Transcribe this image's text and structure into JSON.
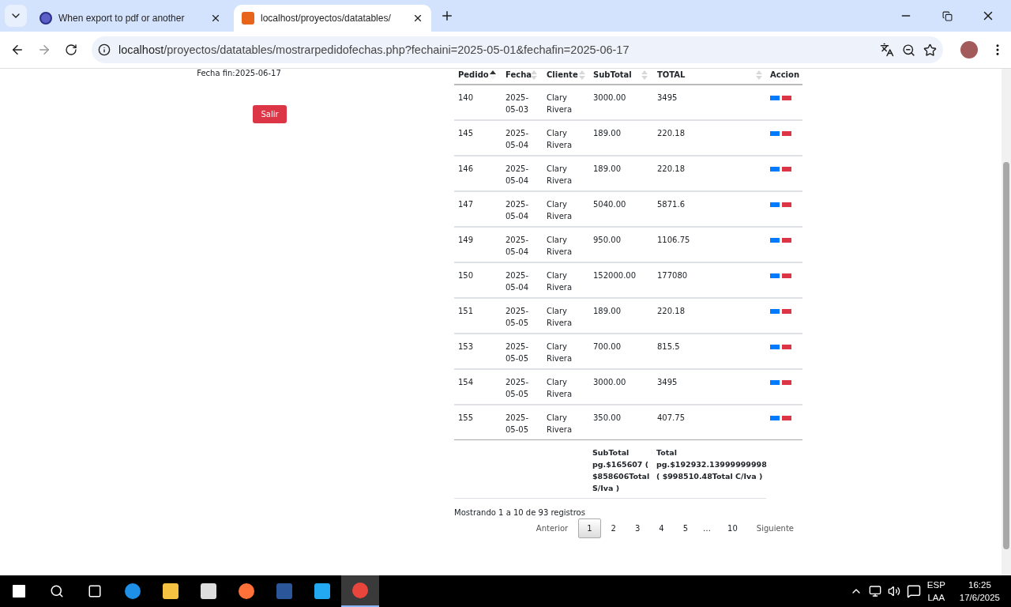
{
  "tabs": [
    {
      "title": "When export to pdf or another",
      "selected": false
    },
    {
      "title": "localhost/proyectos/datatables/",
      "selected": true
    }
  ],
  "address": {
    "host": "localhost",
    "path": "/proyectos/datatables/mostrarpedidofechas.php?fechaini=2025-05-01&fechafin=2025-06-17"
  },
  "page": {
    "date_label": "Fecha fin:2025-06-17",
    "exit_button": "Salir"
  },
  "table": {
    "columns": [
      {
        "label": "Pedido",
        "sortable": true,
        "sorted": true
      },
      {
        "label": "Fecha",
        "sortable": true,
        "sorted": false
      },
      {
        "label": "Cliente",
        "sortable": true,
        "sorted": false
      },
      {
        "label": "SubTotal",
        "sortable": true,
        "sorted": false
      },
      {
        "label": "TOTAL",
        "sortable": true,
        "sorted": false
      },
      {
        "label": "Accion"
      }
    ],
    "rows": [
      {
        "pedido": "140",
        "fecha": "2025-05-03",
        "cliente": "Clary Rivera",
        "subtotal": "3000.00",
        "total": "3495"
      },
      {
        "pedido": "145",
        "fecha": "2025-05-04",
        "cliente": "Clary Rivera",
        "subtotal": "189.00",
        "total": "220.18"
      },
      {
        "pedido": "146",
        "fecha": "2025-05-04",
        "cliente": "Clary Rivera",
        "subtotal": "189.00",
        "total": "220.18"
      },
      {
        "pedido": "147",
        "fecha": "2025-05-04",
        "cliente": "Clary Rivera",
        "subtotal": "5040.00",
        "total": "5871.6"
      },
      {
        "pedido": "149",
        "fecha": "2025-05-04",
        "cliente": "Clary Rivera",
        "subtotal": "950.00",
        "total": "1106.75"
      },
      {
        "pedido": "150",
        "fecha": "2025-05-04",
        "cliente": "Clary Rivera",
        "subtotal": "152000.00",
        "total": "177080"
      },
      {
        "pedido": "151",
        "fecha": "2025-05-05",
        "cliente": "Clary Rivera",
        "subtotal": "189.00",
        "total": "220.18"
      },
      {
        "pedido": "153",
        "fecha": "2025-05-05",
        "cliente": "Clary Rivera",
        "subtotal": "700.00",
        "total": "815.5"
      },
      {
        "pedido": "154",
        "fecha": "2025-05-05",
        "cliente": "Clary Rivera",
        "subtotal": "3000.00",
        "total": "3495"
      },
      {
        "pedido": "155",
        "fecha": "2025-05-05",
        "cliente": "Clary Rivera",
        "subtotal": "350.00",
        "total": "407.75"
      }
    ],
    "footer": {
      "subtotal": "SubTotal pg.$165607 ( $858606Total S/Iva )",
      "total": "Total pg.$192932.13999999998 ( $998510.48Total C/Iva )"
    },
    "info": "Mostrando 1 a 10 de 93 registros",
    "pagination": [
      {
        "label": "Anterior",
        "kind": "nav"
      },
      {
        "label": "1",
        "kind": "page",
        "selected": true
      },
      {
        "label": "2",
        "kind": "page",
        "selected": false
      },
      {
        "label": "3",
        "kind": "page",
        "selected": false
      },
      {
        "label": "4",
        "kind": "page",
        "selected": false
      },
      {
        "label": "5",
        "kind": "page",
        "selected": false
      },
      {
        "label": "…",
        "kind": "ellipsis"
      },
      {
        "label": "10",
        "kind": "page",
        "selected": false
      },
      {
        "label": "Siguiente",
        "kind": "nav"
      }
    ]
  },
  "taskbar": {
    "language": "ESP",
    "layout": "LAA",
    "time": "16:25",
    "date": "17/6/2025"
  }
}
